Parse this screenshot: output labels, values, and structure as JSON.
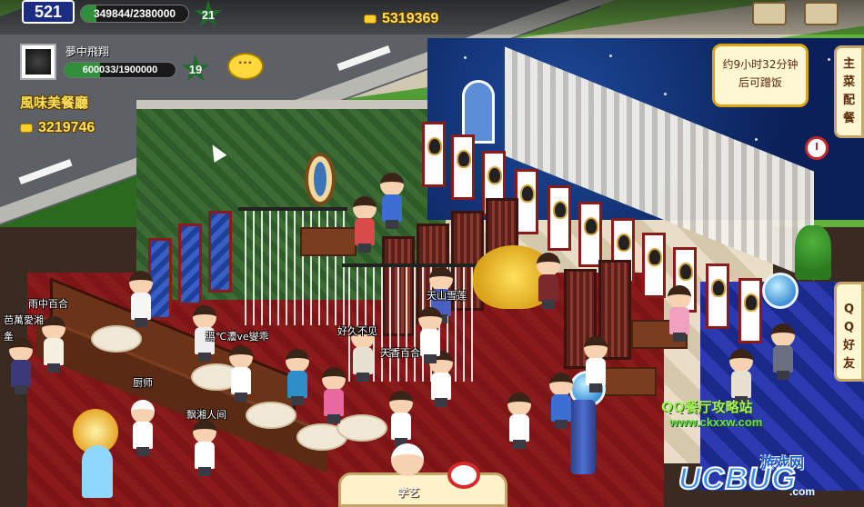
{
  "hud": {
    "level": "521",
    "exp": "349844/2380000",
    "exp_fraction": 0.147,
    "star_level": "21",
    "gold": "5319369"
  },
  "profile": {
    "name": "夢中飛翔",
    "exp": "600033/1900000",
    "exp_fraction": 0.316,
    "level": "19",
    "restaurant_name": "風味美餐廳",
    "gold": "3219746",
    "chat_icon": "speech-bubble-icon"
  },
  "timer": {
    "line1": "约9小时32分钟",
    "line2": "后可蹭饭"
  },
  "side_tabs": {
    "menu": [
      "主",
      "菜",
      "配",
      "餐"
    ],
    "friends": [
      "Q",
      "Q",
      "好",
      "友"
    ]
  },
  "name_tags": [
    "雨中百合",
    "芭萬愛湘",
    "㚅",
    "潙℃灋ve燮乖",
    "好久不见",
    "天山雪莲",
    "天香百合",
    "厨师",
    "飘湘人间"
  ],
  "skill": {
    "label": "学艺"
  },
  "watermark": {
    "title": "QQ餐厅攻略站",
    "url": "www.ckxxw.com"
  },
  "logo": {
    "top": "游戏网",
    "main": "UCBUG",
    "suffix": ".com"
  },
  "colors": {
    "gold_text": "#ffe15a",
    "level_box": "#1b2d82",
    "carpet": "#7d1416",
    "night_wall": "#0b2058"
  }
}
